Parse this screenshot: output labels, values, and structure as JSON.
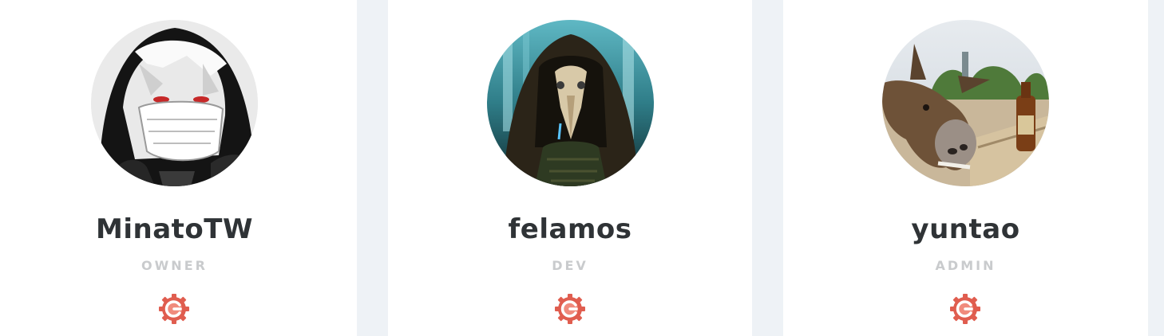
{
  "members": [
    {
      "name": "MinatoTW",
      "role": "OWNER",
      "avatar_icon": "hooded-anime-character-avatar",
      "link_icon": "gitea-gear-icon"
    },
    {
      "name": "felamos",
      "role": "DEV",
      "avatar_icon": "plague-doctor-avatar",
      "link_icon": "gitea-gear-icon"
    },
    {
      "name": "yuntao",
      "role": "ADMIN",
      "avatar_icon": "donkey-photo-avatar",
      "link_icon": "gitea-gear-icon"
    }
  ],
  "colors": {
    "page_background": "#eef2f6",
    "card_background": "#ffffff",
    "name_text": "#2f3336",
    "role_text": "#c9cbcd",
    "icon_accent": "#e05d4f"
  }
}
